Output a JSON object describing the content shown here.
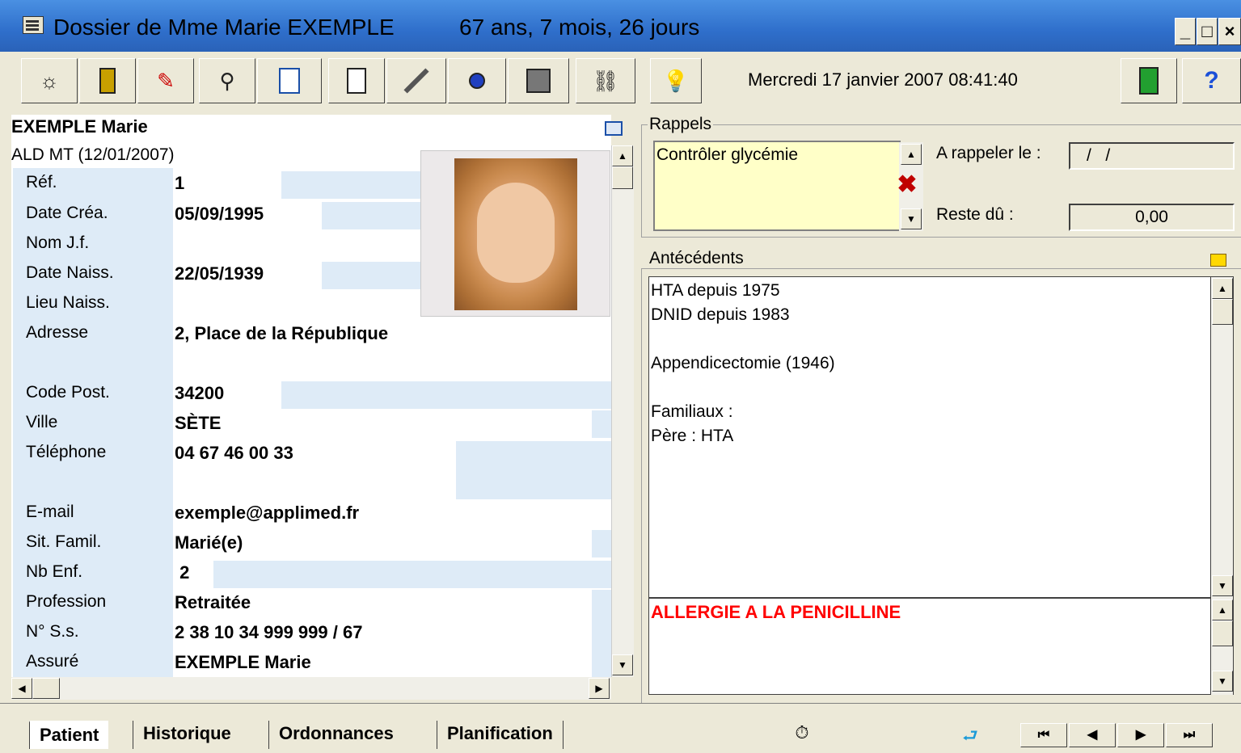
{
  "window": {
    "title_name": "Dossier de Mme Marie EXEMPLE",
    "title_age": "67 ans, 7 mois, 26 jours",
    "minimize_glyph": "_",
    "maximize_glyph": "□",
    "close_glyph": "×"
  },
  "toolbar": {
    "datetime": "Mercredi 17 janvier 2007   08:41:40",
    "icons": [
      "sun-icon",
      "patient-file-icon",
      "pen-icon",
      "magnifier-icon",
      "documents-icon",
      "page-icon",
      "syringe-icon",
      "flask-icon",
      "safe-icon",
      "network-icon",
      "lightbulb-icon",
      "exit-door-icon",
      "help-icon"
    ],
    "help_glyph": "?"
  },
  "patient": {
    "header": "EXEMPLE Marie",
    "ald": "ALD MT (12/01/2007)",
    "fields": [
      {
        "label": "Réf.",
        "value": "1"
      },
      {
        "label": "Date Créa.",
        "value": "05/09/1995"
      },
      {
        "label": "Nom J.f.",
        "value": ""
      },
      {
        "label": "Date Naiss.",
        "value": "22/05/1939"
      },
      {
        "label": "Lieu Naiss.",
        "value": ""
      },
      {
        "label": "Adresse",
        "value": "2, Place de la République"
      },
      {
        "label": "Code Post.",
        "value": "34200"
      },
      {
        "label": "Ville",
        "value": "SÈTE"
      },
      {
        "label": "Téléphone",
        "value": "04 67 46 00 33"
      },
      {
        "label": "E-mail",
        "value": "exemple@applimed.fr"
      },
      {
        "label": "Sit. Famil.",
        "value": "Marié(e)"
      },
      {
        "label": "Nb Enf.",
        "value": " 2"
      },
      {
        "label": "Profession",
        "value": "Retraitée"
      },
      {
        "label": "N° S.s.",
        "value": "2 38 10 34 999 999 / 67"
      },
      {
        "label": "Assuré",
        "value": "EXEMPLE Marie"
      }
    ]
  },
  "rappels": {
    "legend": "Rappels",
    "text": "Contrôler glycémie",
    "a_rappeler_label": "A rappeler le :",
    "a_rappeler_value": "/   /",
    "reste_du_label": "Reste dû :",
    "reste_du_value": "0,00",
    "delete_glyph": "✖"
  },
  "antecedents": {
    "legend": "Antécédents",
    "lines": [
      "HTA depuis 1975",
      "DNID depuis 1983",
      "",
      "Appendicectomie (1946)",
      "",
      "Familiaux :",
      "Père : HTA"
    ],
    "allergy": "ALLERGIE A LA PENICILLINE"
  },
  "tabs": [
    "Patient",
    "Historique",
    "Ordonnances",
    "Planification"
  ],
  "nav": {
    "first": "⏮",
    "prev": "◀",
    "next": "▶",
    "last": "⏭"
  },
  "colors": {
    "label_bg": "#deebf7",
    "rappel_bg": "#ffffc8",
    "allergy": "#ff0000",
    "title_bar": "#2f6fcb"
  }
}
